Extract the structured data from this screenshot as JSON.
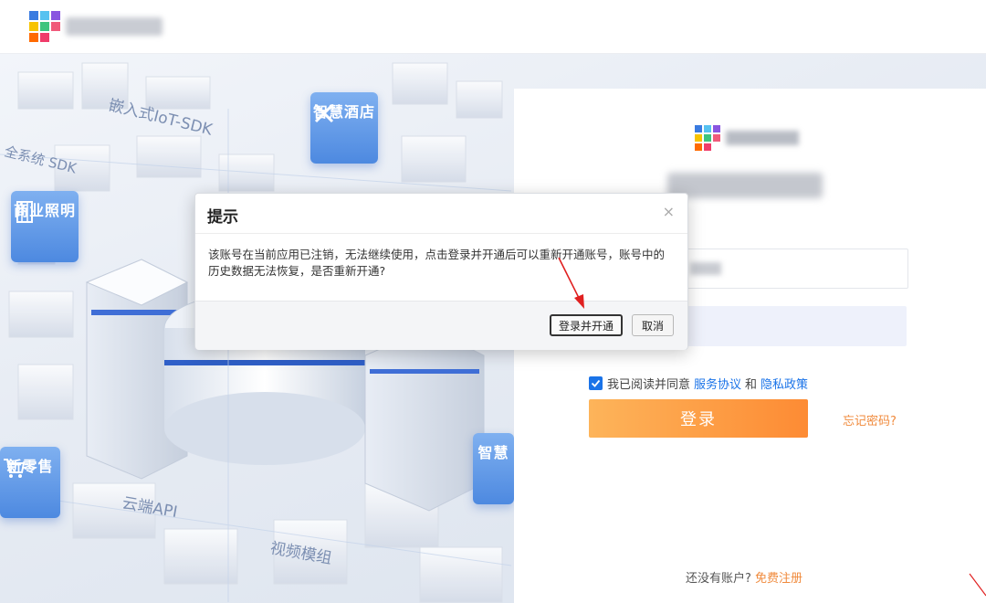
{
  "header": {
    "logo_name": "brand-logo"
  },
  "hero": {
    "labels": [
      "嵌入式IoT-SDK",
      "全系统 SDK",
      "云端API",
      "视频模组"
    ],
    "badges": [
      "智慧酒店",
      "商业照明",
      "新零售",
      "智慧"
    ]
  },
  "login": {
    "agree_prefix": "我已阅读并同意",
    "agree_service": "服务协议",
    "agree_and": "和",
    "agree_privacy": "隐私政策",
    "login_button": "登录",
    "forgot_password": "忘记密码?",
    "no_account": "还没有账户?",
    "register": "免费注册"
  },
  "dialog": {
    "title": "提示",
    "close": "×",
    "message": "该账号在当前应用已注销，无法继续使用，点击登录并开通后可以重新开通账号，账号中的历史数据无法恢复，是否重新开通?",
    "primary_button": "登录并开通",
    "cancel_button": "取消"
  },
  "colors": {
    "accent_blue": "#1a73e8",
    "login_orange_start": "#fdb45a",
    "login_orange_end": "#fd8b34",
    "annotation_red": "#e02020"
  }
}
